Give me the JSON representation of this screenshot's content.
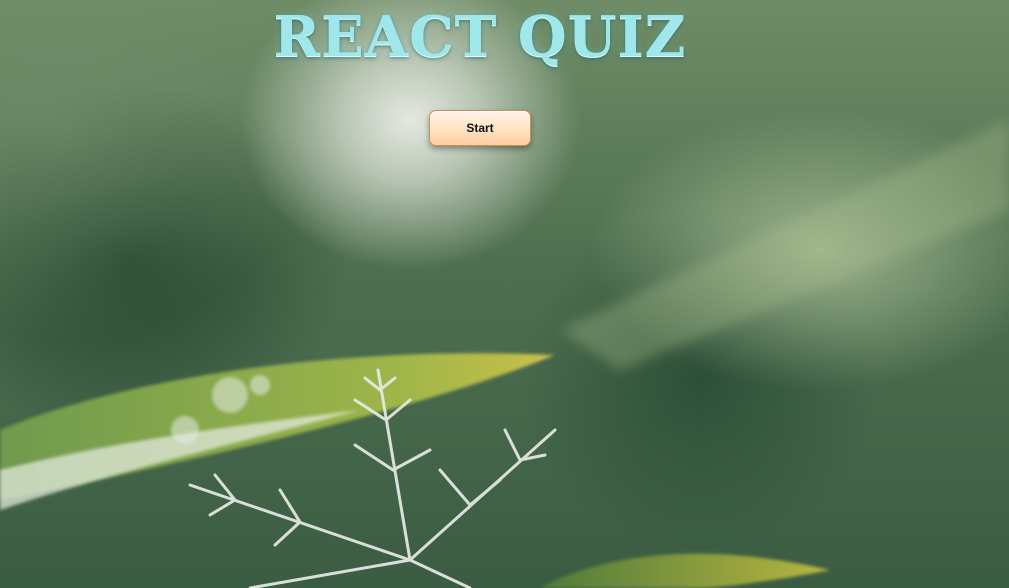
{
  "page": {
    "title": "REACT QUIZ",
    "start_label": "Start"
  },
  "background": {
    "subject": "snowflake-on-leaf-photo"
  },
  "colors": {
    "title": "#9fe7ea",
    "button_top": "#fff4e9",
    "button_bottom": "#ffcda0",
    "button_border": "#c98d55"
  }
}
